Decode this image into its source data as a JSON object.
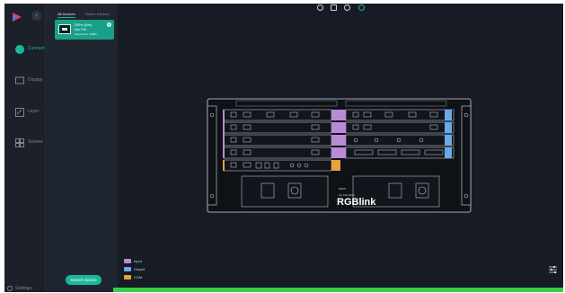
{
  "nav": {
    "items": [
      {
        "id": "connect",
        "label": "Connect",
        "icon": "connect-icon",
        "active": true
      },
      {
        "id": "display",
        "label": "Display",
        "icon": "display-icon"
      },
      {
        "id": "layer",
        "label": "Layer",
        "icon": "layer-icon"
      },
      {
        "id": "scenes",
        "label": "Scenes",
        "icon": "scenes-icon"
      }
    ],
    "settings_label": "Settings"
  },
  "panel": {
    "tabs": [
      "All Devices",
      "Online Devices"
    ],
    "device": {
      "name": "D3Pro (Dev)",
      "model": "Dev FW:",
      "serial": "Serial Num: 33891"
    },
    "search_label": "Search Device"
  },
  "device": {
    "brand": "RGBlink",
    "hdmi_label": "HDMI",
    "small_label": "AC 100-240V"
  },
  "legend": [
    {
      "label": "Input",
      "color": "#b98bd6"
    },
    {
      "label": "Output",
      "color": "#6aa8e6"
    },
    {
      "label": "COM",
      "color": "#e7a23b"
    }
  ],
  "colors": {
    "accent": "#19b89a",
    "progress": "#35d04b"
  },
  "progress": 1.0
}
